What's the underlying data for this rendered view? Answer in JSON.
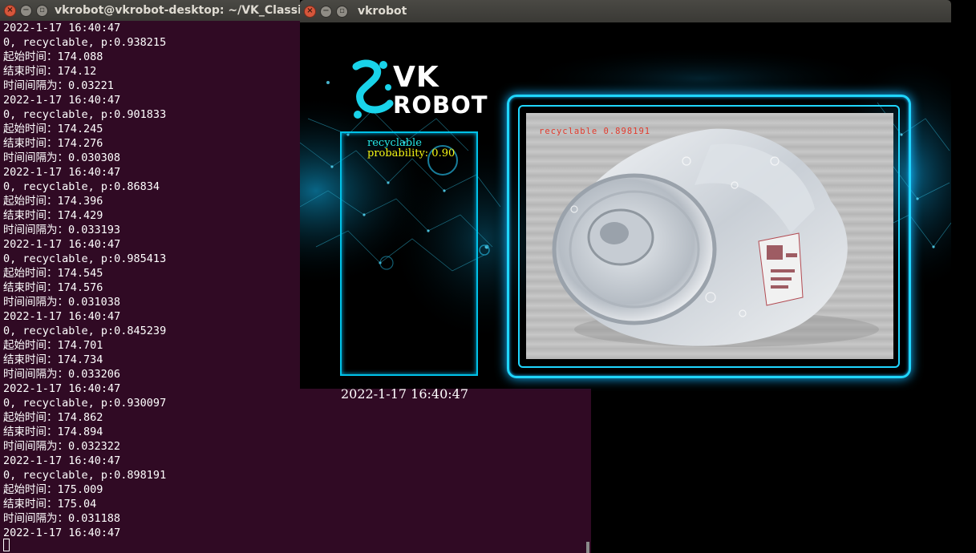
{
  "terminal": {
    "title": "vkrobot@vkrobot-desktop: ~/VK_Classific",
    "lines": [
      "2022-1-17 16:40:47",
      "0, recyclable, p:0.938215",
      "起始时间：174.088",
      "结束时间：174.12",
      "时间间隔为：0.03221",
      "2022-1-17 16:40:47",
      "0, recyclable, p:0.901833",
      "起始时间：174.245",
      "结束时间：174.276",
      "时间间隔为：0.030308",
      "2022-1-17 16:40:47",
      "0, recyclable, p:0.86834",
      "起始时间：174.396",
      "结束时间：174.429",
      "时间间隔为：0.033193",
      "2022-1-17 16:40:47",
      "0, recyclable, p:0.985413",
      "起始时间：174.545",
      "结束时间：174.576",
      "时间间隔为：0.031038",
      "2022-1-17 16:40:47",
      "0, recyclable, p:0.845239",
      "起始时间：174.701",
      "结束时间：174.734",
      "时间间隔为：0.033206",
      "2022-1-17 16:40:47",
      "0, recyclable, p:0.930097",
      "起始时间：174.862",
      "结束时间：174.894",
      "时间间隔为：0.032322",
      "2022-1-17 16:40:47",
      "0, recyclable, p:0.898191",
      "起始时间：175.009",
      "结束时间：175.04",
      "时间间隔为：0.031188",
      "2022-1-17 16:40:47"
    ]
  },
  "vkwindow": {
    "title": "vkrobot",
    "logo_line1": "VK",
    "logo_line2": "ROBOT",
    "result_label": "recyclable",
    "result_probability": "probability: 0.90",
    "datetime": "2022-1-17 16:40:47",
    "camera_overlay": "recyclable 0.898191"
  },
  "colors": {
    "terminal_bg": "#300a24",
    "accent_cyan": "#1fd6ff",
    "label_cyan": "#25e8e8",
    "prob_yellow": "#f5f514",
    "overlay_red": "#e23a2c"
  },
  "icons": {
    "window_close": "close-icon",
    "window_minimize": "minimize-icon",
    "window_maximize": "maximize-icon"
  }
}
